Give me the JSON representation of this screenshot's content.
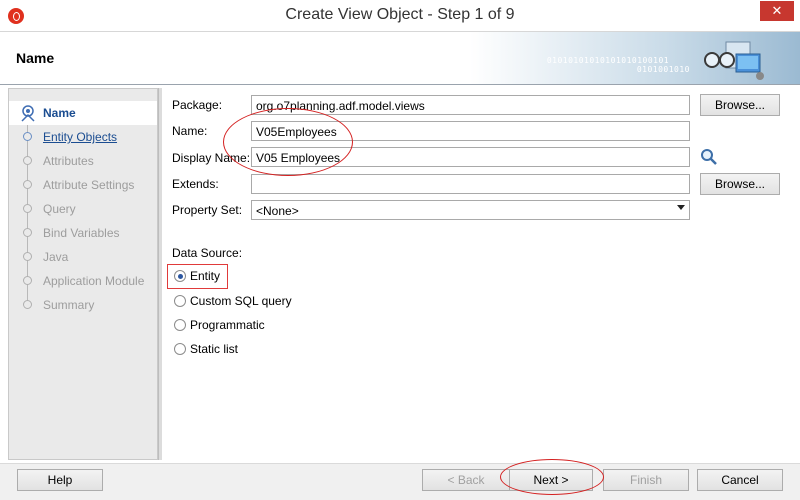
{
  "window": {
    "title": "Create View Object - Step 1 of 9",
    "close_label": "✕"
  },
  "header": {
    "title": "Name",
    "binary_text": "01010101010101010100101",
    "binary_text2": "0101001010"
  },
  "sidebar": {
    "steps": [
      {
        "label": "Name",
        "state": "current"
      },
      {
        "label": "Entity Objects",
        "state": "link"
      },
      {
        "label": "Attributes",
        "state": "disabled"
      },
      {
        "label": "Attribute Settings",
        "state": "disabled"
      },
      {
        "label": "Query",
        "state": "disabled"
      },
      {
        "label": "Bind Variables",
        "state": "disabled"
      },
      {
        "label": "Java",
        "state": "disabled"
      },
      {
        "label": "Application Module",
        "state": "disabled"
      },
      {
        "label": "Summary",
        "state": "disabled"
      }
    ]
  },
  "form": {
    "package_label": "Package:",
    "package_value": "org.o7planning.adf.model.views",
    "name_label": "Name:",
    "name_value": "V05Employees",
    "display_name_label": "Display Name:",
    "display_name_value": "V05 Employees",
    "extends_label": "Extends:",
    "extends_value": "",
    "property_set_label": "Property Set:",
    "property_set_value": "<None>",
    "browse_label": "Browse..."
  },
  "data_source": {
    "label": "Data Source:",
    "options": [
      {
        "label": "Entity",
        "checked": true
      },
      {
        "label": "Custom SQL query",
        "checked": false
      },
      {
        "label": "Programmatic",
        "checked": false
      },
      {
        "label": "Static list",
        "checked": false
      }
    ]
  },
  "footer": {
    "help_label": "Help",
    "back_label": "< Back",
    "next_label": "Next >",
    "finish_label": "Finish",
    "cancel_label": "Cancel"
  },
  "colors": {
    "accent_link": "#1b4d91",
    "annotation": "#d42121",
    "close": "#c7372f"
  }
}
